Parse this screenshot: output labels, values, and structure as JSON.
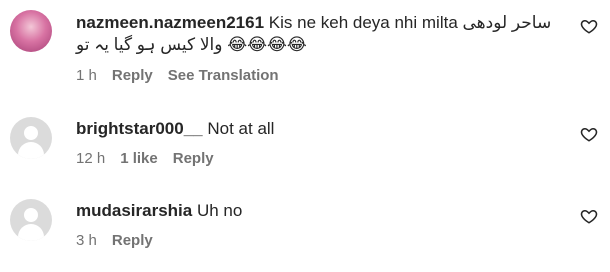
{
  "comments": [
    {
      "username": "nazmeen.nazmeen2161",
      "text_ltr": "Kis ne keh deya nhi milta",
      "text_urdu_1": "ساحر لودھی",
      "text_urdu_2": "والا کیس ہو گیا یہ تو",
      "emojis": "😂😂😂😂",
      "time": "1 h",
      "reply": "Reply",
      "translate": "See Translation",
      "avatar": "profile-photo"
    },
    {
      "username": "brightstar000__",
      "text": "Not at all",
      "time": "12 h",
      "likes": "1 like",
      "reply": "Reply",
      "avatar": "default-avatar"
    },
    {
      "username": "mudasirarshia",
      "text": "Uh no",
      "time": "3 h",
      "reply": "Reply",
      "avatar": "default-avatar"
    }
  ],
  "icons": {
    "like": "heart-outline-icon"
  },
  "colors": {
    "text": "#262626",
    "meta": "#737373",
    "avatar_default": "#dbdbdb"
  }
}
